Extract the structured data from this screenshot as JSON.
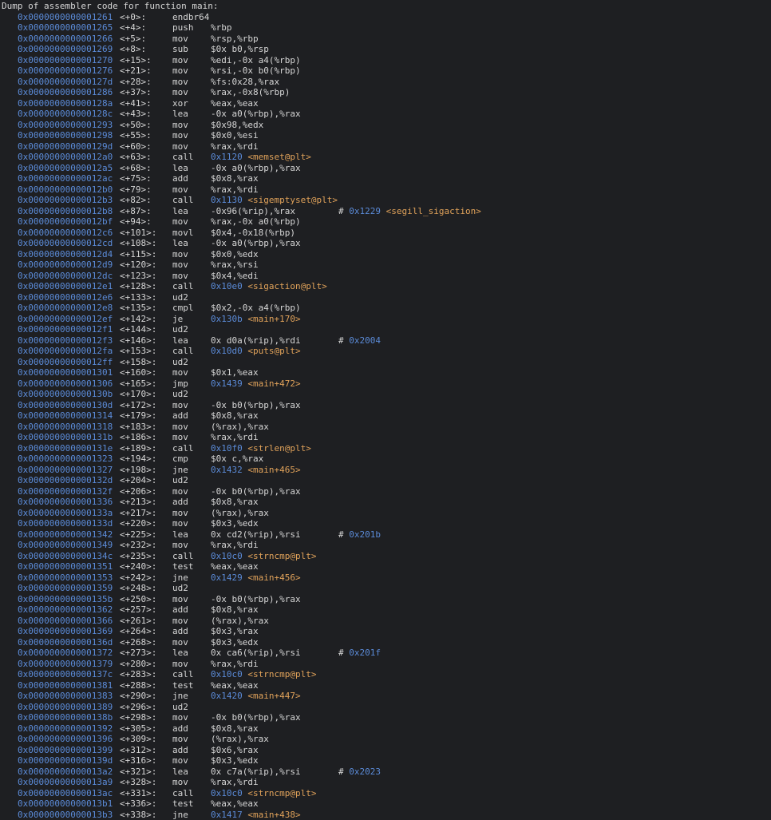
{
  "colors": {
    "background": "#1e1f22",
    "text": "#d6d6d6",
    "address": "#5b8bd8",
    "symbol": "#e0a25a"
  },
  "header": "Dump of assembler code for function main:",
  "lines": [
    {
      "addr": "0x0000000000001261",
      "off": "<+0>:",
      "mnem": "endbr64",
      "ops": ""
    },
    {
      "addr": "0x0000000000001265",
      "off": "<+4>:",
      "mnem": "push",
      "ops": "%rbp"
    },
    {
      "addr": "0x0000000000001266",
      "off": "<+5>:",
      "mnem": "mov",
      "ops": "%rsp,%rbp"
    },
    {
      "addr": "0x0000000000001269",
      "off": "<+8>:",
      "mnem": "sub",
      "ops": "$0x b0,%rsp"
    },
    {
      "addr": "0x0000000000001270",
      "off": "<+15>:",
      "mnem": "mov",
      "ops": "%edi,-0x a4(%rbp)"
    },
    {
      "addr": "0x0000000000001276",
      "off": "<+21>:",
      "mnem": "mov",
      "ops": "%rsi,-0x b0(%rbp)"
    },
    {
      "addr": "0x000000000000127d",
      "off": "<+28>:",
      "mnem": "mov",
      "ops": "%fs:0x28,%rax"
    },
    {
      "addr": "0x0000000000001286",
      "off": "<+37>:",
      "mnem": "mov",
      "ops": "%rax,-0x8(%rbp)"
    },
    {
      "addr": "0x000000000000128a",
      "off": "<+41>:",
      "mnem": "xor",
      "ops": "%eax,%eax"
    },
    {
      "addr": "0x000000000000128c",
      "off": "<+43>:",
      "mnem": "lea",
      "ops": "-0x a0(%rbp),%rax"
    },
    {
      "addr": "0x0000000000001293",
      "off": "<+50>:",
      "mnem": "mov",
      "ops": "$0x98,%edx"
    },
    {
      "addr": "0x0000000000001298",
      "off": "<+55>:",
      "mnem": "mov",
      "ops": "$0x0,%esi"
    },
    {
      "addr": "0x000000000000129d",
      "off": "<+60>:",
      "mnem": "mov",
      "ops": "%rax,%rdi"
    },
    {
      "addr": "0x00000000000012a0",
      "off": "<+63>:",
      "mnem": "call",
      "target": "0x1120",
      "sym": "<memset@plt>"
    },
    {
      "addr": "0x00000000000012a5",
      "off": "<+68>:",
      "mnem": "lea",
      "ops": "-0x a0(%rbp),%rax"
    },
    {
      "addr": "0x00000000000012ac",
      "off": "<+75>:",
      "mnem": "add",
      "ops": "$0x8,%rax"
    },
    {
      "addr": "0x00000000000012b0",
      "off": "<+79>:",
      "mnem": "mov",
      "ops": "%rax,%rdi"
    },
    {
      "addr": "0x00000000000012b3",
      "off": "<+82>:",
      "mnem": "call",
      "target": "0x1130",
      "sym": "<sigemptyset@plt>"
    },
    {
      "addr": "0x00000000000012b8",
      "off": "<+87>:",
      "mnem": "lea",
      "ops": "-0x96(%rip),%rax",
      "cmt_target": "0x1229",
      "cmt_sym": "<segill_sigaction>"
    },
    {
      "addr": "0x00000000000012bf",
      "off": "<+94>:",
      "mnem": "mov",
      "ops": "%rax,-0x a0(%rbp)"
    },
    {
      "addr": "0x00000000000012c6",
      "off": "<+101>:",
      "mnem": "movl",
      "ops": "$0x4,-0x18(%rbp)"
    },
    {
      "addr": "0x00000000000012cd",
      "off": "<+108>:",
      "mnem": "lea",
      "ops": "-0x a0(%rbp),%rax"
    },
    {
      "addr": "0x00000000000012d4",
      "off": "<+115>:",
      "mnem": "mov",
      "ops": "$0x0,%edx"
    },
    {
      "addr": "0x00000000000012d9",
      "off": "<+120>:",
      "mnem": "mov",
      "ops": "%rax,%rsi"
    },
    {
      "addr": "0x00000000000012dc",
      "off": "<+123>:",
      "mnem": "mov",
      "ops": "$0x4,%edi"
    },
    {
      "addr": "0x00000000000012e1",
      "off": "<+128>:",
      "mnem": "call",
      "target": "0x10e0",
      "sym": "<sigaction@plt>"
    },
    {
      "addr": "0x00000000000012e6",
      "off": "<+133>:",
      "mnem": "ud2",
      "ops": ""
    },
    {
      "addr": "0x00000000000012e8",
      "off": "<+135>:",
      "mnem": "cmpl",
      "ops": "$0x2,-0x a4(%rbp)"
    },
    {
      "addr": "0x00000000000012ef",
      "off": "<+142>:",
      "mnem": "je",
      "target": "0x130b",
      "sym": "<main+170>"
    },
    {
      "addr": "0x00000000000012f1",
      "off": "<+144>:",
      "mnem": "ud2",
      "ops": ""
    },
    {
      "addr": "0x00000000000012f3",
      "off": "<+146>:",
      "mnem": "lea",
      "ops": "0x d0a(%rip),%rdi",
      "cmt_target": "0x2004"
    },
    {
      "addr": "0x00000000000012fa",
      "off": "<+153>:",
      "mnem": "call",
      "target": "0x10d0",
      "sym": "<puts@plt>"
    },
    {
      "addr": "0x00000000000012ff",
      "off": "<+158>:",
      "mnem": "ud2",
      "ops": ""
    },
    {
      "addr": "0x0000000000001301",
      "off": "<+160>:",
      "mnem": "mov",
      "ops": "$0x1,%eax"
    },
    {
      "addr": "0x0000000000001306",
      "off": "<+165>:",
      "mnem": "jmp",
      "target": "0x1439",
      "sym": "<main+472>"
    },
    {
      "addr": "0x000000000000130b",
      "off": "<+170>:",
      "mnem": "ud2",
      "ops": ""
    },
    {
      "addr": "0x000000000000130d",
      "off": "<+172>:",
      "mnem": "mov",
      "ops": "-0x b0(%rbp),%rax"
    },
    {
      "addr": "0x0000000000001314",
      "off": "<+179>:",
      "mnem": "add",
      "ops": "$0x8,%rax"
    },
    {
      "addr": "0x0000000000001318",
      "off": "<+183>:",
      "mnem": "mov",
      "ops": "(%rax),%rax"
    },
    {
      "addr": "0x000000000000131b",
      "off": "<+186>:",
      "mnem": "mov",
      "ops": "%rax,%rdi"
    },
    {
      "addr": "0x000000000000131e",
      "off": "<+189>:",
      "mnem": "call",
      "target": "0x10f0",
      "sym": "<strlen@plt>"
    },
    {
      "addr": "0x0000000000001323",
      "off": "<+194>:",
      "mnem": "cmp",
      "ops": "$0x c,%rax"
    },
    {
      "addr": "0x0000000000001327",
      "off": "<+198>:",
      "mnem": "jne",
      "target": "0x1432",
      "sym": "<main+465>"
    },
    {
      "addr": "0x000000000000132d",
      "off": "<+204>:",
      "mnem": "ud2",
      "ops": ""
    },
    {
      "addr": "0x000000000000132f",
      "off": "<+206>:",
      "mnem": "mov",
      "ops": "-0x b0(%rbp),%rax"
    },
    {
      "addr": "0x0000000000001336",
      "off": "<+213>:",
      "mnem": "add",
      "ops": "$0x8,%rax"
    },
    {
      "addr": "0x000000000000133a",
      "off": "<+217>:",
      "mnem": "mov",
      "ops": "(%rax),%rax"
    },
    {
      "addr": "0x000000000000133d",
      "off": "<+220>:",
      "mnem": "mov",
      "ops": "$0x3,%edx"
    },
    {
      "addr": "0x0000000000001342",
      "off": "<+225>:",
      "mnem": "lea",
      "ops": "0x cd2(%rip),%rsi",
      "cmt_target": "0x201b"
    },
    {
      "addr": "0x0000000000001349",
      "off": "<+232>:",
      "mnem": "mov",
      "ops": "%rax,%rdi"
    },
    {
      "addr": "0x000000000000134c",
      "off": "<+235>:",
      "mnem": "call",
      "target": "0x10c0",
      "sym": "<strncmp@plt>"
    },
    {
      "addr": "0x0000000000001351",
      "off": "<+240>:",
      "mnem": "test",
      "ops": "%eax,%eax"
    },
    {
      "addr": "0x0000000000001353",
      "off": "<+242>:",
      "mnem": "jne",
      "target": "0x1429",
      "sym": "<main+456>"
    },
    {
      "addr": "0x0000000000001359",
      "off": "<+248>:",
      "mnem": "ud2",
      "ops": ""
    },
    {
      "addr": "0x000000000000135b",
      "off": "<+250>:",
      "mnem": "mov",
      "ops": "-0x b0(%rbp),%rax"
    },
    {
      "addr": "0x0000000000001362",
      "off": "<+257>:",
      "mnem": "add",
      "ops": "$0x8,%rax"
    },
    {
      "addr": "0x0000000000001366",
      "off": "<+261>:",
      "mnem": "mov",
      "ops": "(%rax),%rax"
    },
    {
      "addr": "0x0000000000001369",
      "off": "<+264>:",
      "mnem": "add",
      "ops": "$0x3,%rax"
    },
    {
      "addr": "0x000000000000136d",
      "off": "<+268>:",
      "mnem": "mov",
      "ops": "$0x3,%edx"
    },
    {
      "addr": "0x0000000000001372",
      "off": "<+273>:",
      "mnem": "lea",
      "ops": "0x ca6(%rip),%rsi",
      "cmt_target": "0x201f"
    },
    {
      "addr": "0x0000000000001379",
      "off": "<+280>:",
      "mnem": "mov",
      "ops": "%rax,%rdi"
    },
    {
      "addr": "0x000000000000137c",
      "off": "<+283>:",
      "mnem": "call",
      "target": "0x10c0",
      "sym": "<strncmp@plt>"
    },
    {
      "addr": "0x0000000000001381",
      "off": "<+288>:",
      "mnem": "test",
      "ops": "%eax,%eax"
    },
    {
      "addr": "0x0000000000001383",
      "off": "<+290>:",
      "mnem": "jne",
      "target": "0x1420",
      "sym": "<main+447>"
    },
    {
      "addr": "0x0000000000001389",
      "off": "<+296>:",
      "mnem": "ud2",
      "ops": ""
    },
    {
      "addr": "0x000000000000138b",
      "off": "<+298>:",
      "mnem": "mov",
      "ops": "-0x b0(%rbp),%rax"
    },
    {
      "addr": "0x0000000000001392",
      "off": "<+305>:",
      "mnem": "add",
      "ops": "$0x8,%rax"
    },
    {
      "addr": "0x0000000000001396",
      "off": "<+309>:",
      "mnem": "mov",
      "ops": "(%rax),%rax"
    },
    {
      "addr": "0x0000000000001399",
      "off": "<+312>:",
      "mnem": "add",
      "ops": "$0x6,%rax"
    },
    {
      "addr": "0x000000000000139d",
      "off": "<+316>:",
      "mnem": "mov",
      "ops": "$0x3,%edx"
    },
    {
      "addr": "0x00000000000013a2",
      "off": "<+321>:",
      "mnem": "lea",
      "ops": "0x c7a(%rip),%rsi",
      "cmt_target": "0x2023"
    },
    {
      "addr": "0x00000000000013a9",
      "off": "<+328>:",
      "mnem": "mov",
      "ops": "%rax,%rdi"
    },
    {
      "addr": "0x00000000000013ac",
      "off": "<+331>:",
      "mnem": "call",
      "target": "0x10c0",
      "sym": "<strncmp@plt>"
    },
    {
      "addr": "0x00000000000013b1",
      "off": "<+336>:",
      "mnem": "test",
      "ops": "%eax,%eax"
    },
    {
      "addr": "0x00000000000013b3",
      "off": "<+338>:",
      "mnem": "jne",
      "target": "0x1417",
      "sym": "<main+438>"
    }
  ]
}
